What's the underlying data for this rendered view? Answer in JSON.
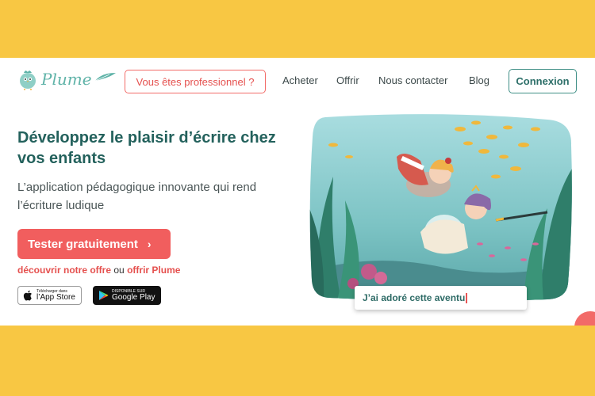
{
  "brand": {
    "name": "Plume"
  },
  "nav": {
    "pro_button": "Vous êtes professionnel ?",
    "items": [
      {
        "label": "Acheter"
      },
      {
        "label": "Offrir"
      },
      {
        "label": "Nous contacter"
      },
      {
        "label": "Blog"
      }
    ],
    "login_button": "Connexion"
  },
  "hero": {
    "title": "Développez le plaisir d’écrire chez vos enfants",
    "subtitle": "L’application pédagogique innovante qui rend l’écriture ludique",
    "cta_label": "Tester gratuitement",
    "cta_chevron": "›",
    "link_discover": "découvrir notre offre",
    "link_or": "ou",
    "link_gift": "offrir Plume"
  },
  "stores": {
    "appstore_small": "Télécharger dans",
    "appstore_big": "l’App Store",
    "gplay_small": "DISPONIBLE SUR",
    "gplay_big": "Google Play"
  },
  "illustration": {
    "typing_text": "J’ai adoré cette aventu"
  },
  "colors": {
    "background": "#f8c743",
    "accent_red": "#f15e5e",
    "brand_teal": "#23615c"
  }
}
